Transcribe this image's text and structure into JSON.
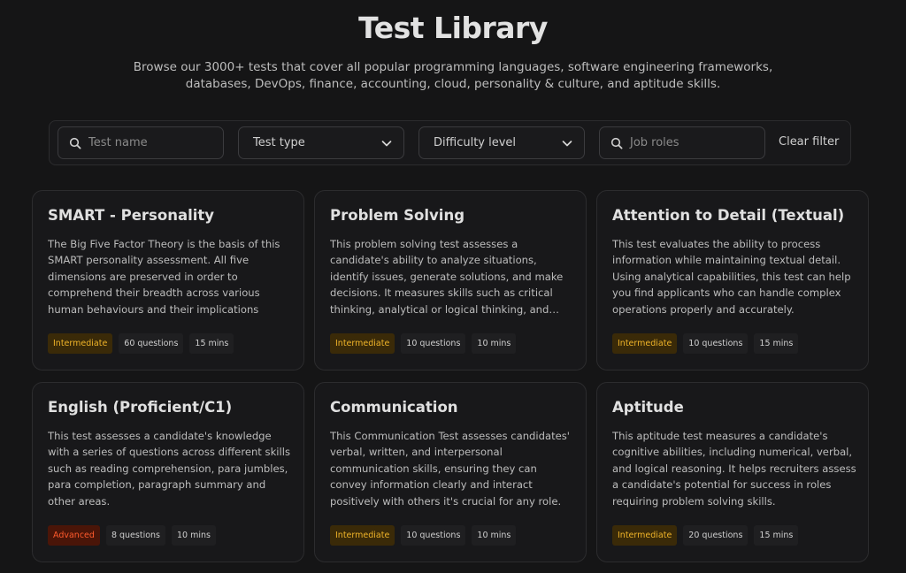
{
  "header": {
    "title": "Test Library",
    "subtitle": "Browse our 3000+ tests that cover all popular programming languages, software engineering frameworks, databases, DevOps, finance, accounting, cloud, personality & culture, and aptitude skills."
  },
  "filters": {
    "test_name_placeholder": "Test name",
    "test_type_label": "Test type",
    "difficulty_label": "Difficulty level",
    "job_roles_placeholder": "Job roles",
    "clear_label": "Clear filter"
  },
  "cards": [
    {
      "title": "SMART - Personality",
      "description": "The Big Five Factor Theory is the basis of this SMART personality assessment. All five dimensions are preserved in order to comprehend their breadth across various human behaviours and their implications",
      "level": "Intermediate",
      "questions": "60 questions",
      "duration": "15 mins"
    },
    {
      "title": "Problem Solving",
      "description": "This problem solving test assesses a candidate's ability to analyze situations, identify issues, generate solutions, and make decisions. It measures skills such as critical thinking, analytical or logical thinking, and problem solving.",
      "level": "Intermediate",
      "questions": "10 questions",
      "duration": "10 mins"
    },
    {
      "title": "Attention to Detail (Textual)",
      "description": "This test evaluates the ability to process information while maintaining textual detail. Using analytical capabilities, this test can help you find applicants who can handle complex operations properly and accurately.",
      "level": "Intermediate",
      "questions": "10 questions",
      "duration": "15 mins"
    },
    {
      "title": "English (Proficient/C1)",
      "description": "This test assesses a candidate's knowledge with a series of questions across different skills such as reading comprehension, para jumbles, para completion, paragraph summary and other areas.",
      "level": "Advanced",
      "questions": "8 questions",
      "duration": "10 mins"
    },
    {
      "title": "Communication",
      "description": "This Communication Test assesses candidates' verbal, written, and interpersonal communication skills, ensuring they can convey information clearly and interact positively with others it's crucial for any role.",
      "level": "Intermediate",
      "questions": "10 questions",
      "duration": "10 mins"
    },
    {
      "title": "Aptitude",
      "description": "This aptitude test measures a candidate's cognitive abilities, including numerical, verbal, and logical reasoning. It helps recruiters assess a candidate's potential for success in roles requiring problem solving skills.",
      "level": "Intermediate",
      "questions": "20 questions",
      "duration": "15 mins"
    }
  ],
  "colors": {
    "background": "#151516",
    "intermediate_badge_text": "#f0b429",
    "advanced_badge_text": "#ff5a2c"
  },
  "icons": {
    "search": "search-icon",
    "dropdown": "chevron-down-icon"
  }
}
